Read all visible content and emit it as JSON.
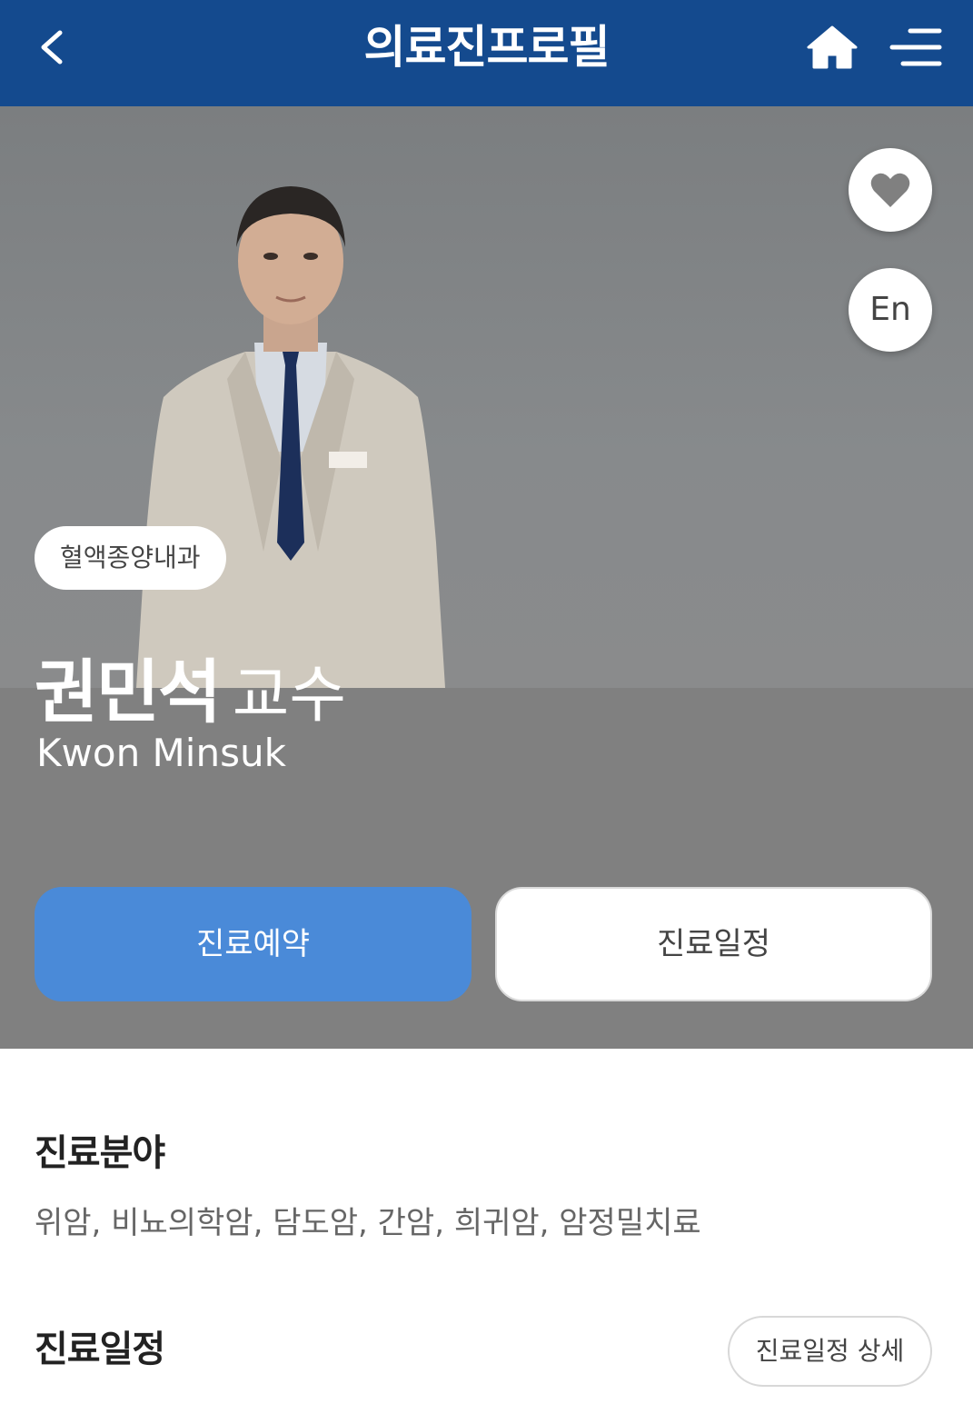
{
  "header": {
    "title": "의료진프로필",
    "back_icon": "chevron-left-icon",
    "home_icon": "home-icon",
    "menu_icon": "hamburger-menu-icon",
    "bg_color": "#144a8e"
  },
  "profile": {
    "favorite_icon": "heart-icon",
    "language_toggle": "En",
    "department": "혈액종양내과",
    "name": "권민석",
    "title": "교수",
    "name_en": "Kwon Minsuk"
  },
  "actions": {
    "reserve_label": "진료예약",
    "schedule_label": "진료일정",
    "reserve_color": "#4a8ad8"
  },
  "specialty": {
    "heading": "진료분야",
    "text": "위암, 비뇨의학암, 담도암, 간암, 희귀암, 암정밀치료"
  },
  "schedule": {
    "heading": "진료일정",
    "detail_label": "진료일정 상세"
  }
}
